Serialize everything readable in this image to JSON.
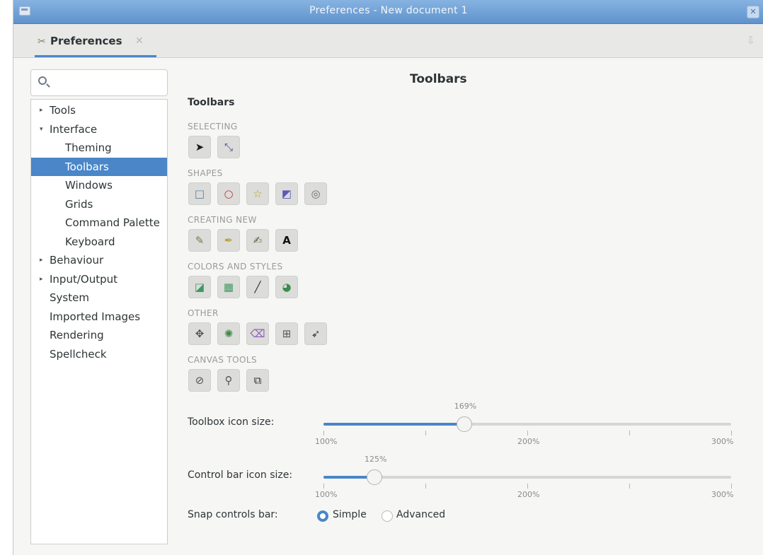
{
  "window": {
    "title": "Preferences - New document 1",
    "close_glyph": "✕"
  },
  "tab": {
    "label": "Preferences",
    "icon": "preferences-icon"
  },
  "search": {
    "placeholder": "",
    "value": ""
  },
  "tree": {
    "items": [
      {
        "label": "Tools",
        "arrow": "▸",
        "level": 0
      },
      {
        "label": "Interface",
        "arrow": "▾",
        "level": 0
      },
      {
        "label": "Theming",
        "arrow": "",
        "level": 1
      },
      {
        "label": "Toolbars",
        "arrow": "",
        "level": 1,
        "selected": true
      },
      {
        "label": "Windows",
        "arrow": "",
        "level": 1
      },
      {
        "label": "Grids",
        "arrow": "",
        "level": 1
      },
      {
        "label": "Command Palette",
        "arrow": "",
        "level": 1
      },
      {
        "label": "Keyboard",
        "arrow": "",
        "level": 1
      },
      {
        "label": "Behaviour",
        "arrow": "▸",
        "level": 0
      },
      {
        "label": "Input/Output",
        "arrow": "▸",
        "level": 0
      },
      {
        "label": "System",
        "arrow": "",
        "level": 0
      },
      {
        "label": "Imported Images",
        "arrow": "",
        "level": 0
      },
      {
        "label": "Rendering",
        "arrow": "",
        "level": 0
      },
      {
        "label": "Spellcheck",
        "arrow": "",
        "level": 0
      }
    ]
  },
  "main": {
    "title": "Toolbars",
    "subtitle": "Toolbars",
    "groups": [
      {
        "label": "SELECTING",
        "buttons": [
          {
            "icon": "selector-arrow-icon",
            "glyph": "➤",
            "color": "#1a1a1a"
          },
          {
            "icon": "node-editor-icon",
            "glyph": "⤡",
            "color": "#4b4b8f"
          }
        ]
      },
      {
        "label": "SHAPES",
        "buttons": [
          {
            "icon": "rectangle-icon",
            "glyph": "□",
            "color": "#5b7fa8"
          },
          {
            "icon": "ellipse-icon",
            "glyph": "○",
            "color": "#c0392b"
          },
          {
            "icon": "star-icon",
            "glyph": "☆",
            "color": "#c2a032"
          },
          {
            "icon": "box3d-icon",
            "glyph": "◩",
            "color": "#5a5ab8"
          },
          {
            "icon": "spiral-icon",
            "glyph": "◎",
            "color": "#6b6b6b"
          }
        ]
      },
      {
        "label": "CREATING NEW",
        "buttons": [
          {
            "icon": "pencil-icon",
            "glyph": "✎",
            "color": "#7a7a50"
          },
          {
            "icon": "pen-icon",
            "glyph": "✒",
            "color": "#c2a032"
          },
          {
            "icon": "calligraphy-icon",
            "glyph": "✍",
            "color": "#4d6b3a"
          },
          {
            "icon": "text-icon",
            "glyph": "A",
            "color": "#111111"
          }
        ]
      },
      {
        "label": "COLORS AND STYLES",
        "buttons": [
          {
            "icon": "gradient-icon",
            "glyph": "◪",
            "color": "#3c9a5f"
          },
          {
            "icon": "mesh-icon",
            "glyph": "▦",
            "color": "#3c9a5f"
          },
          {
            "icon": "dropper-icon",
            "glyph": "╱",
            "color": "#333333"
          },
          {
            "icon": "paint-bucket-icon",
            "glyph": "◕",
            "color": "#3c8c4a"
          }
        ]
      },
      {
        "label": "OTHER",
        "buttons": [
          {
            "icon": "tweak-icon",
            "glyph": "✥",
            "color": "#555555"
          },
          {
            "icon": "spray-icon",
            "glyph": "✺",
            "color": "#3c8c4a"
          },
          {
            "icon": "eraser-icon",
            "glyph": "⌫",
            "color": "#8b5ab8"
          },
          {
            "icon": "connector-icon",
            "glyph": "⊞",
            "color": "#555555"
          },
          {
            "icon": "lpe-tool-icon",
            "glyph": "➶",
            "color": "#333333"
          }
        ]
      },
      {
        "label": "CANVAS TOOLS",
        "buttons": [
          {
            "icon": "measure-icon",
            "glyph": "⊘",
            "color": "#555555"
          },
          {
            "icon": "zoom-icon",
            "glyph": "⚲",
            "color": "#555555"
          },
          {
            "icon": "pages-icon",
            "glyph": "⧉",
            "color": "#333333"
          }
        ]
      }
    ],
    "sliders": [
      {
        "label": "Toolbox icon size:",
        "value_label": "169%",
        "value_fraction": 0.345,
        "ticks": [
          "100%",
          "",
          "200%",
          "",
          "300%"
        ]
      },
      {
        "label": "Control bar icon size:",
        "value_label": "125%",
        "value_fraction": 0.125,
        "ticks": [
          "100%",
          "",
          "200%",
          "",
          "300%"
        ]
      }
    ],
    "snap": {
      "label": "Snap controls bar:",
      "options": [
        {
          "label": "Simple",
          "selected": true
        },
        {
          "label": "Advanced",
          "selected": false
        }
      ]
    }
  },
  "colors": {
    "accent": "#4a86c8",
    "title_gradient_top": "#86b3e1"
  }
}
